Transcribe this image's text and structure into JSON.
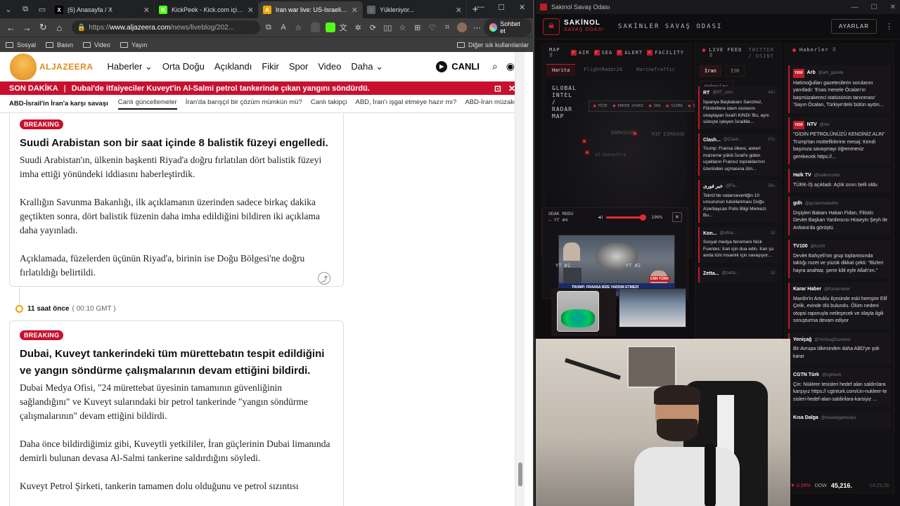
{
  "browser": {
    "tabs": [
      {
        "title": "(6) Anasayfa / X",
        "fav": "X",
        "color": "#000000"
      },
      {
        "title": "KickPeek - Kick.com için Gerç",
        "fav": "K",
        "color": "#53fc18"
      },
      {
        "title": "Iran war live: US-Israeli strike",
        "fav": "A",
        "color": "#f4a300",
        "active": true
      },
      {
        "title": "Yükleniyor...",
        "fav": "◌",
        "color": "#5f6368"
      }
    ],
    "url": {
      "prefix": "https://",
      "domain": "www.aljazeera.com",
      "path": "/news/liveblog/202..."
    },
    "copilot_label": "Sohbet et",
    "bookmarks": [
      "Sosyal",
      "Basın",
      "Video",
      "Yayın"
    ],
    "bookmarks_right": "Diğer sık kullanılanlar"
  },
  "site": {
    "logo_text": "ALJAZEERA",
    "nav": [
      "Haberler",
      "Orta Doğu",
      "Açıklandı",
      "Fikir",
      "Spor",
      "Video",
      "Daha"
    ],
    "live_label": "CANLI",
    "breaking": {
      "label": "SON DAKİKA",
      "text": "Dubai'de itfaiyeciler Kuveyt'in Al-Salmi petrol tankerinde çıkan yangını söndürdü."
    },
    "subnav": {
      "title": "ABD-İsrail'in İran'a karşı savaşı",
      "items": [
        "Canlı güncellemeler",
        "İran'da barışçıl bir çözüm mümkün mü?",
        "Canlı takipçi",
        "ABD, İran'ı işgal etmeye hazır mı?",
        "ABD-İran müzakereleri h"
      ]
    },
    "posts": [
      {
        "badge": "BREAKING",
        "headline": "Suudi Arabistan son bir saat içinde 8 balistik füzeyi engelledi.",
        "paragraphs": [
          "Suudi Arabistan'ın, ülkenin başkenti Riyad'a doğru fırlatılan dört balistik füzeyi imha ettiği yönündeki iddiasını haberleştirdik.",
          "Krallığın Savunma Bakanlığı, ilk açıklamanın üzerinden sadece birkaç dakika geçtikten sonra, dört balistik füzenin daha imha edildiğini bildiren iki açıklama daha yayınladı.",
          "Açıklamada, füzelerden üçünün Riyad'a, birinin ise Doğu Bölgesi'ne doğru fırlatıldığı belirtildi."
        ]
      },
      {
        "time_ago": "11 saat önce",
        "time_gmt": "( 00:10 GMT )",
        "badge": "BREAKING",
        "headline": "Dubai, Kuveyt tankerindeki tüm mürettebatın tespit edildiğini ve yangın söndürme çalışmalarının devam ettiğini bildirdi.",
        "paragraphs": [
          "Dubai Medya Ofisi, \"24 mürettebat üyesinin tamamının güvenliğinin sağlandığını\" ve Kuveyt sularındaki bir petrol tankerinde \"yangın söndürme çalışmalarının\" devam ettiğini bildirdi.",
          "Daha önce bildirdiğimiz gibi, Kuveytli yetkililer, İran güçlerinin Dubai limanında demirli bulunan devasa Al-Salmi tankerine saldırdığını söyledi.",
          "Kuveyt Petrol Şirketi, tankerin tamamen dolu olduğunu ve petrol sızıntısı"
        ]
      }
    ]
  },
  "app": {
    "window_title": "Sakinol Savaş Odası",
    "brand": "SAKİNOL",
    "brand_sub": "SAVAŞ ODASI",
    "title": "SAKİNLER SAVAŞ ODASI",
    "settings": "AYARLAR",
    "map": {
      "label": "MAP ⠿",
      "filters": [
        "AIR",
        "SEA",
        "ALERT",
        "FACILITY"
      ],
      "tabs": [
        "Harita",
        "FlightRadar24",
        "MarineTraffic"
      ],
      "legend": [
        "GLOBAL",
        "INTEL",
        "/",
        "RADAR",
        "MAP"
      ],
      "stats": [
        "FÜZE",
        "ERKEN UYARI",
        "İHA",
        "SİZMA",
        "SİV"
      ],
      "places": [
        "DAMASCUS",
        "RIF DIMASHQ",
        "Al-Qunaytira"
      ]
    },
    "focus": {
      "label": "ODAK MODU — YT #4",
      "volume": "100%",
      "yt_labels": [
        "YT #1",
        "YT #2"
      ],
      "video_banner": "TRUMP: FRANSA BİZE YARDIM ETMEDİ",
      "video_badge": "CNN TÜRK"
    },
    "livefeed": {
      "label": "LIVE FEED ⠿",
      "sub": "TWITTER / OSINT",
      "tabs": [
        "İran",
        "İSR",
        "Haberler"
      ],
      "items": [
        {
          "src": "RT",
          "handle": "@RT_com",
          "time": "44s",
          "text": "İspanya Başbakanı Sanchez, Filistinlilere idam cezasını onaylayan İsrail'i KINDI 'Bu, aynı süreçte işleyen İsraillile..."
        },
        {
          "src": "Clash...",
          "handle": "@Clash...",
          "time": "57s",
          "text": "Trump: Fransa ülkesi, askeri malzeme yüklü İsrail'e giden uçakların Fransız topraklarının üzerinden uçmasına izin..."
        },
        {
          "src": "خبر فوری",
          "handle": "@Fa...",
          "time": "58s",
          "text": "Tebriz'de vatanseverliğin 10 unsurunun tutuklanması Doğu Azerbaycan Polis Bilgi Merkezi: Bu..."
        },
        {
          "src": "Kon...",
          "handle": "@ultrar...",
          "time": "1d",
          "text": "Sosyal medya fenomeni Nick Fuentes: İran için dua edin. İran şu anda tüm insanlık için savaşıyor..."
        },
        {
          "src": "Zetta...",
          "handle": "@zetta...",
          "time": "1d",
          "text": ""
        }
      ]
    },
    "news": {
      "label": "Haberler ⠿",
      "items": [
        {
          "src": "Arb",
          "handle": "@arti_gazete",
          "new": true,
          "text": "Hatimoğulları gazetecilerin sorularını yanıtladı: 'Esas mesele Öcalan'ın başmüzakereci statüsünün tanınması' 'Sayın Öcalan, Türkiye'deki bütün aydın..."
        },
        {
          "src": "NTV",
          "handle": "@ntv",
          "new": true,
          "text": "\"GİDİN PETROLÜNÜZÜ KENDİNİZ ALIN\" Trump'tan müttefiklerine mesaj: Kendi başınıza savaşmayı öğrenmeniz gerekecek https://..."
        },
        {
          "src": "Halk TV",
          "handle": "@halktvcomtr",
          "new": false,
          "text": "TÜRK-İŞ açıkladı: Açlık sınırı belli oldu"
        },
        {
          "src": "gdh",
          "handle": "@gundemedairhs",
          "new": false,
          "text": "Dışişleri Bakanı Hakan Fidan, Filistin Devlet Başkan Yardımcısı Hüseyin Şeyh ile Ankara'da görüştü."
        },
        {
          "src": "TV100",
          "handle": "@tv100",
          "new": false,
          "text": "Devlet Bahçeli'nin grup toplantısında taktığı rozet ve yüzük dikkat çekti: \"Bizleri hayra anahtar, şerre kilit eyle Allah'ım.\""
        },
        {
          "src": "Karar Haber",
          "handle": "@KararHaber",
          "new": false,
          "text": "Mardin'in Artuklu ilçesinde eski hemşire Elif Çelik, evinde ölü bulundu. Ölüm nedeni otopsi raporuyla netleşecek ve olayla ilgili soruşturma devam ediyor"
        },
        {
          "src": "Yeniçağ",
          "handle": "@YenicagGazetesi",
          "new": false,
          "text": "Bir Avrupa ülkesinden daha ABD'ye şok karar"
        },
        {
          "src": "CGTN Türk",
          "handle": "@cgtnturk",
          "new": false,
          "text": "Çin: Nükleer tesisleri hedef alan saldırılara karşıyız https:// cgtnturk.com/cin-nukleer-te sisleri-hedef-alan-saldirilara-karsiyiz ..."
        },
        {
          "src": "Kısa Dalga",
          "handle": "@kisadalgamedya",
          "new": false,
          "text": ""
        }
      ]
    },
    "ticker": {
      "pct": "▼ 0.39%",
      "sym": "DOW",
      "val": "45,216.",
      "time": "14:25:28"
    }
  },
  "colors": {
    "aj_red": "#c8102e",
    "aj_orange": "#e08a1e",
    "app_red": "#e62834",
    "app_bg": "#0e0d10"
  }
}
